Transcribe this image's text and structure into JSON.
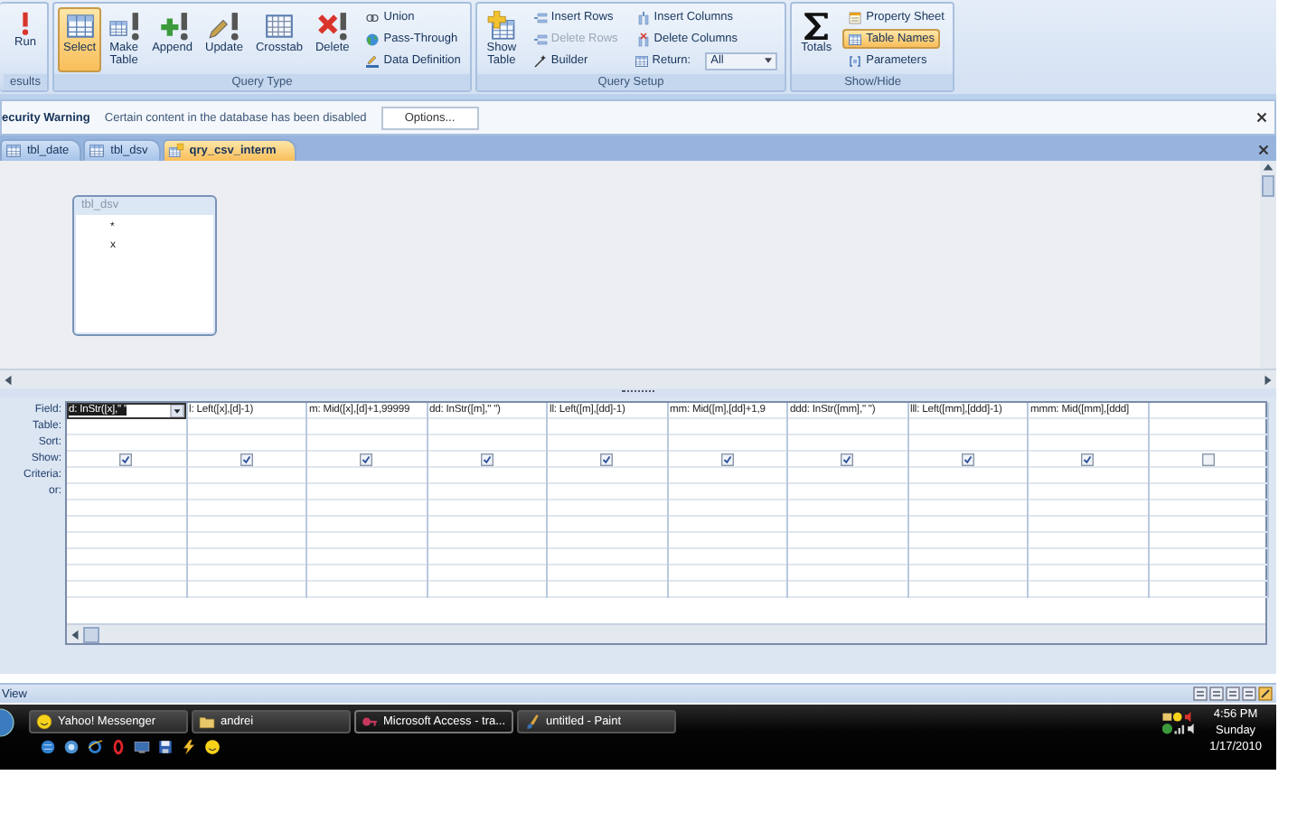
{
  "ribbon": {
    "groups": [
      {
        "label": "esults",
        "large": [
          {
            "label": "Run",
            "kind": "run",
            "selected": false
          }
        ]
      },
      {
        "label": "Query Type",
        "large": [
          {
            "label": "Select",
            "kind": "select",
            "selected": true
          },
          {
            "label": "Make Table",
            "kind": "maketable",
            "selected": false
          },
          {
            "label": "Append",
            "kind": "append",
            "selected": false
          },
          {
            "label": "Update",
            "kind": "update",
            "selected": false
          },
          {
            "label": "Crosstab",
            "kind": "crosstab",
            "selected": false
          },
          {
            "label": "Delete",
            "kind": "delete",
            "selected": false
          }
        ],
        "small": [
          {
            "label": "Union",
            "kind": "union",
            "selected": false,
            "disabled": false
          },
          {
            "label": "Pass-Through",
            "kind": "passthrough",
            "selected": false,
            "disabled": false
          },
          {
            "label": "Data Definition",
            "kind": "datadef",
            "selected": false,
            "disabled": false
          }
        ]
      },
      {
        "label": "Query Setup",
        "large": [
          {
            "label": "Show Table",
            "kind": "showtable",
            "selected": false
          }
        ],
        "small": [
          {
            "label": "Insert Rows",
            "kind": "insertrows",
            "selected": false,
            "disabled": false
          },
          {
            "label": "Delete Rows",
            "kind": "deleterows",
            "selected": false,
            "disabled": true
          },
          {
            "label": "Builder",
            "kind": "builder",
            "selected": false,
            "disabled": false
          },
          {
            "label": "Insert Columns",
            "kind": "insertcols",
            "selected": false,
            "disabled": false
          },
          {
            "label": "Delete Columns",
            "kind": "deletecols",
            "selected": false,
            "disabled": false
          },
          {
            "label": "Return:",
            "kind": "combo",
            "value": "All"
          }
        ]
      },
      {
        "label": "Show/Hide",
        "large": [
          {
            "label": "Totals",
            "kind": "totals",
            "selected": false
          }
        ],
        "small": [
          {
            "label": "Property Sheet",
            "kind": "propsheet",
            "selected": false,
            "disabled": false
          },
          {
            "label": "Table Names",
            "kind": "tablenames",
            "selected": true,
            "disabled": false
          },
          {
            "label": "Parameters",
            "kind": "parameters",
            "selected": false,
            "disabled": false
          }
        ]
      }
    ]
  },
  "security_bar": {
    "title": "ecurity Warning",
    "message": "Certain content in the database has been disabled",
    "button": "Options..."
  },
  "tabs": [
    {
      "label": "tbl_date",
      "kind": "table",
      "selected": false
    },
    {
      "label": "tbl_dsv",
      "kind": "table",
      "selected": false
    },
    {
      "label": "qry_csv_interm",
      "kind": "query",
      "selected": true
    }
  ],
  "field_list": {
    "title": "tbl_dsv",
    "fields": [
      "*",
      "x"
    ]
  },
  "grid": {
    "row_labels": [
      "Field:",
      "Table:",
      "Sort:",
      "Show:",
      "Criteria:",
      "or:"
    ],
    "columns": [
      {
        "field": "d: InStr([x],\" \"",
        "show": true,
        "selected": true
      },
      {
        "field": "l: Left([x],[d]-1)",
        "show": true,
        "selected": false
      },
      {
        "field": "m: Mid([x],[d]+1,99999",
        "show": true,
        "selected": false
      },
      {
        "field": "dd: InStr([m],\" \")",
        "show": true,
        "selected": false
      },
      {
        "field": "ll: Left([m],[dd]-1)",
        "show": true,
        "selected": false
      },
      {
        "field": "mm: Mid([m],[dd]+1,9",
        "show": true,
        "selected": false
      },
      {
        "field": "ddd: InStr([mm],\" \")",
        "show": true,
        "selected": false
      },
      {
        "field": "lll: Left([mm],[ddd]-1)",
        "show": true,
        "selected": false
      },
      {
        "field": "mmm: Mid([mm],[ddd]",
        "show": true,
        "selected": false
      },
      {
        "show": false,
        "selected": false
      }
    ]
  },
  "status_bar": {
    "text": "View"
  },
  "taskbar": {
    "tasks": [
      {
        "label": "Yahoo! Messenger",
        "kind": "messenger",
        "selected": false
      },
      {
        "label": "andrei",
        "kind": "folder",
        "selected": false
      },
      {
        "label": "Microsoft Access - tra...",
        "kind": "access",
        "selected": true
      },
      {
        "label": "untitled - Paint",
        "kind": "paint",
        "selected": false
      }
    ],
    "clock": {
      "time": "4:56 PM",
      "day": "Sunday",
      "date": "1/17/2010"
    }
  }
}
